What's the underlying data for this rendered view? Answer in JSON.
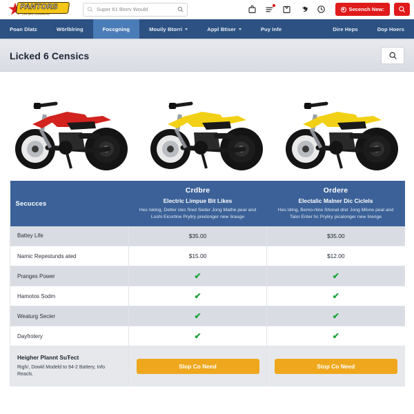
{
  "topbar": {
    "logo_text": "PANTORS",
    "logo_tagline": "Dire pers Glosseernes",
    "search_placeholder": "Super 61 Btorv Would",
    "search_value": "",
    "icons": [
      {
        "name": "bag-icon"
      },
      {
        "name": "list-icon"
      },
      {
        "name": "box-icon"
      },
      {
        "name": "bird-icon"
      },
      {
        "name": "clock-icon"
      }
    ],
    "primary_button": "Secench New:",
    "search_button_label": ""
  },
  "nav": {
    "items": [
      {
        "label": "Poan Dlatz",
        "active": false,
        "caret": false
      },
      {
        "label": "Wörlblring",
        "active": false,
        "caret": false
      },
      {
        "label": "Foccgning",
        "active": true,
        "caret": false
      },
      {
        "label": "Mouily Btorri",
        "active": false,
        "caret": true
      },
      {
        "label": "Appl Btiser",
        "active": false,
        "caret": true
      },
      {
        "label": "Puy Infe",
        "active": false,
        "caret": false
      }
    ],
    "right_items": [
      {
        "label": "Dire Heps"
      },
      {
        "label": "Dop Hoers"
      }
    ]
  },
  "pagehead": {
    "title": "Licked 6 Censics",
    "search_icon": "search-icon"
  },
  "hero": {
    "bikes": [
      {
        "name": "bike-red",
        "color": "#d2231f",
        "accent": "#1b1b1b"
      },
      {
        "name": "bike-yellow-1",
        "color": "#f2d015",
        "accent": "#1b1b1b"
      },
      {
        "name": "bike-yellow-2",
        "color": "#f2d015",
        "accent": "#1b1b1b"
      }
    ]
  },
  "table": {
    "header": {
      "feature_label": "Secucces",
      "products": [
        {
          "name": "Crdbre",
          "subtitle": "Electric Limpue Bit Likes",
          "description": "Hes Isking, Detter clec fired Seder Jong Mathe pear and Loshi Eicortine Pryliry predonger new Iirauge"
        },
        {
          "name": "Ordere",
          "subtitle": "Electalic Malner Dic Ciclels",
          "description": "Hes Iding, Bemo-rline Shonal drer Jong Mlone peal and Talor Enter hc Pryliry picalonger new Iirenge"
        }
      ]
    },
    "rows": [
      {
        "feature": "Battey Life",
        "values": [
          "$35.00",
          "$35.00"
        ],
        "type": "text"
      },
      {
        "feature": "Namic Repestunds ated",
        "values": [
          "$15.00",
          "$12.00"
        ],
        "type": "text"
      },
      {
        "feature": "Pranges Power",
        "values": [
          "✔",
          "✔"
        ],
        "type": "check"
      },
      {
        "feature": "Hamotos Sodm",
        "values": [
          "✔",
          "✔"
        ],
        "type": "check"
      },
      {
        "feature": "Weaturg Secier",
        "values": [
          "✔",
          "✔"
        ],
        "type": "check"
      },
      {
        "feature": "Dayfrotery",
        "values": [
          "✔",
          "✔"
        ],
        "type": "check"
      }
    ],
    "footer": {
      "title": "Heigher Plannt SuŦect",
      "description": "Righ/, Dowkl Modeld to 94-2 Battery, Info Reacls.",
      "cta_labels": [
        "Slop Co Need",
        "Stop Co Need"
      ]
    }
  },
  "colors": {
    "nav_bg": "#2c5182",
    "nav_active": "#4a7cb8",
    "table_header": "#3b6198",
    "cta": "#efa81d",
    "accent_red": "#e01b1b",
    "check_green": "#16a336"
  }
}
